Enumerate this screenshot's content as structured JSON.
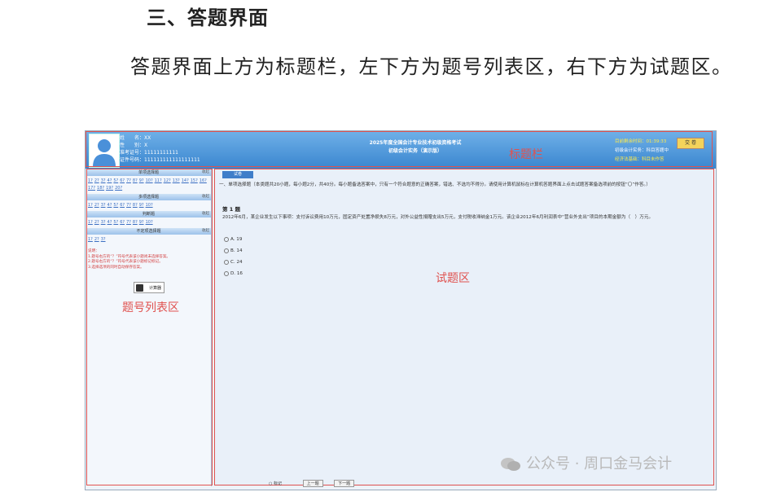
{
  "article": {
    "heading": "三、答题界面",
    "paragraph": "答题界面上方为标题栏，左下方为题号列表区，右下方为试题区。"
  },
  "screenshot": {
    "candidate": {
      "name_label": "姓　　名：",
      "name_value": "XX",
      "gender_label": "性　　别：",
      "gender_value": "X",
      "ticket_label": "准考证号：",
      "ticket_value": "11111111111",
      "id_label": "证件号码：",
      "id_value": "111111111111111111"
    },
    "exam_title_line1": "2025年度全国会计专业技术初级资格考试",
    "exam_title_line2": "初级会计实务（演示版）",
    "timer": "目前剩余时间：01:39:33",
    "submit": "交 卷",
    "subject_line": "初级会计实务：科目答题中",
    "subject_line2": "经济法基础：科目未作答",
    "left_panel": {
      "sections": [
        {
          "title": "单项选择题",
          "fold": "收起",
          "nums": [
            "1",
            "2",
            "3",
            "4",
            "5",
            "6",
            "7",
            "8",
            "9",
            "10",
            "11",
            "12",
            "13",
            "14",
            "15",
            "16",
            "17",
            "18",
            "19",
            "20"
          ]
        },
        {
          "title": "多项选择题",
          "fold": "收起",
          "nums": [
            "1",
            "2",
            "3",
            "4",
            "5",
            "6",
            "7",
            "8",
            "9",
            "10"
          ]
        },
        {
          "title": "判断题",
          "fold": "收起",
          "nums": [
            "1",
            "2",
            "3",
            "4",
            "5",
            "6",
            "7",
            "8",
            "9",
            "10"
          ]
        },
        {
          "title": "不定项选择题",
          "fold": "收起",
          "nums": [
            "1",
            "2",
            "3"
          ]
        }
      ],
      "notes_title": "说明：",
      "note1": "1.题号右方的“？”符号代表该小题尚未选择答案。",
      "note2": "2.题号右方的“？”符号代表该小题标记标记。",
      "note3": "3.选择选项的同时自动保存答案。",
      "calculator": "计算器"
    },
    "right_panel": {
      "tab": "试卷",
      "instructions": "一、单项选择题（本类题共20小题，每小题2分，共40分。每小题备选答案中，只有一个符合题意的正确答案，错选、不选均不得分。请使用计算机鼠标在计算机答题界面上点击试题答案备选项前的按钮“〇”作答。）",
      "question_no": "第 1 题",
      "question": "2012年6月，某企业发生以下事项：支付诉讼费用10万元，固定资产处置净损失8万元，对外公益性捐赠支出5万元，支付税收滞纳金1万元。该企业2012年6月利润表中“营业外支出”项目的本期金额为（　）万元。",
      "options": [
        "A. 19",
        "B. 14",
        "C. 24",
        "D. 16"
      ]
    },
    "labels": {
      "title_bar": "标题栏",
      "number_list": "题号列表区",
      "question_area": "试题区"
    },
    "bottom_nav": {
      "mark": "标记",
      "prev": "上一题",
      "next": "下一题"
    }
  },
  "watermark": "公众号 · 周口金马会计"
}
